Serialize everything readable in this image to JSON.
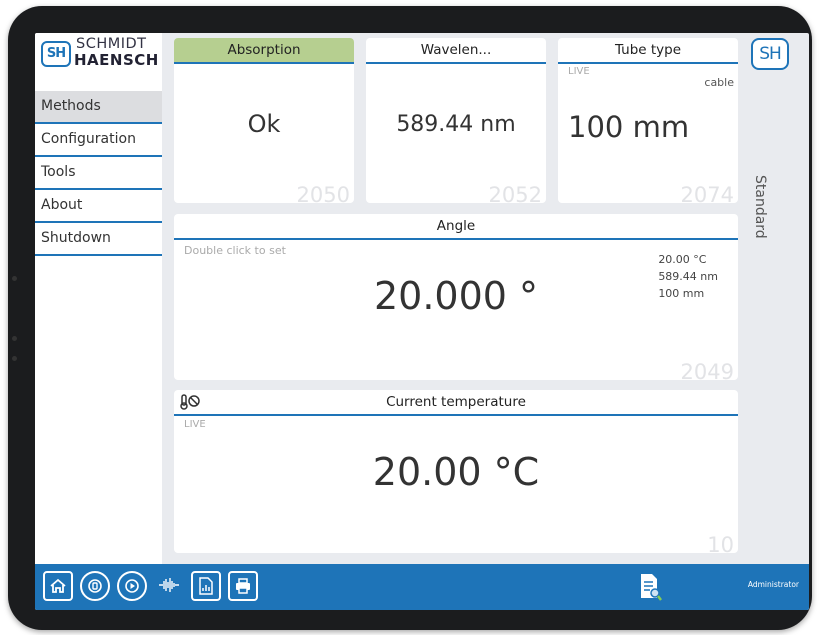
{
  "brand": {
    "badge": "SH",
    "line1": "SCHMIDT",
    "line2": "HAENSCH",
    "corner_badge": "SH"
  },
  "nav": {
    "items": [
      {
        "label": "Methods"
      },
      {
        "label": "Configuration"
      },
      {
        "label": "Tools"
      },
      {
        "label": "About"
      },
      {
        "label": "Shutdown"
      }
    ]
  },
  "mode_label": "Standard",
  "panels": {
    "absorption": {
      "title": "Absorption",
      "value": "Ok",
      "id": "2050"
    },
    "wavelength": {
      "title": "Wavelen...",
      "value": "589.44 nm",
      "id": "2052"
    },
    "tube": {
      "title": "Tube type",
      "live": "LIVE",
      "sub": "cable",
      "value": "100 mm",
      "id": "2074"
    },
    "angle": {
      "title": "Angle",
      "hint": "Double click to set",
      "value": "20.000 °",
      "info": [
        "20.00 °C",
        "589.44 nm",
        "100 mm"
      ],
      "id": "2049"
    },
    "temperature": {
      "title": "Current temperature",
      "live": "LIVE",
      "value": "20.00 °C",
      "id": "10"
    }
  },
  "toolbar": {
    "icons": [
      "home-icon",
      "stop-icon",
      "play-icon",
      "waveform-icon",
      "report-icon",
      "print-icon",
      "document-search-icon"
    ],
    "user": "Administrator"
  },
  "colors": {
    "accent": "#1e74b8",
    "header_green": "#b6cf90",
    "background": "#e9ebef"
  }
}
